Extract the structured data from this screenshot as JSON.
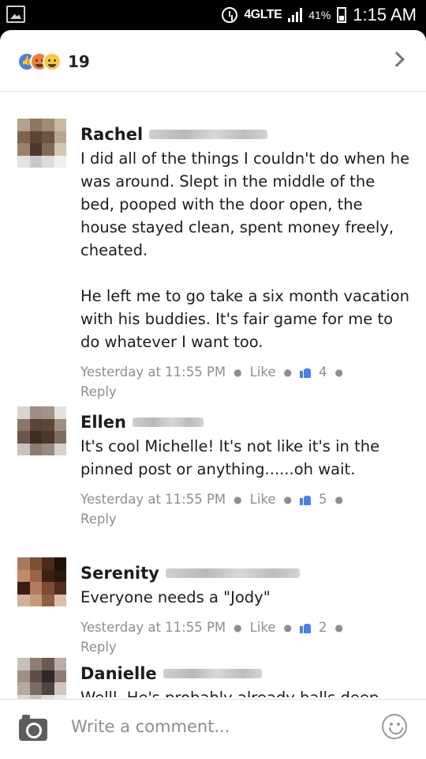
{
  "status_bar": {
    "network": "4GLTE",
    "battery": "41%",
    "time": "1:15 AM"
  },
  "reactions": {
    "count": "19",
    "types": [
      "like",
      "angry",
      "haha"
    ]
  },
  "comments": [
    {
      "name": "Rachel",
      "text": "I did all of the things I couldn't do when he was around. Slept in the middle of the bed, pooped with the door open, the house stayed clean, spent money freely, cheated.\n\nHe left me to go take a six month vacation with his buddies. It's fair game for me to do whatever I want too.",
      "time": "Yesterday at 11:55 PM",
      "like": "Like",
      "likes": "4",
      "reply": "Reply"
    },
    {
      "name": "Ellen",
      "text": "It's cool Michelle! It's not like it's in the pinned post or anything......oh wait.",
      "time": "Yesterday at 11:55 PM",
      "like": "Like",
      "likes": "5",
      "reply": "Reply"
    },
    {
      "name": "Serenity",
      "text": "Everyone needs a \"Jody\"",
      "time": "Yesterday at 11:55 PM",
      "like": "Like",
      "likes": "2",
      "reply": "Reply"
    },
    {
      "name": "Danielle",
      "text": "Welll. He's probably already balls deep",
      "time": "",
      "like": "",
      "likes": "",
      "reply": ""
    }
  ],
  "footer": {
    "placeholder": "Write a comment..."
  },
  "colors": {
    "accent": "#4a7fe8",
    "meta_text": "#8e8e8e"
  }
}
